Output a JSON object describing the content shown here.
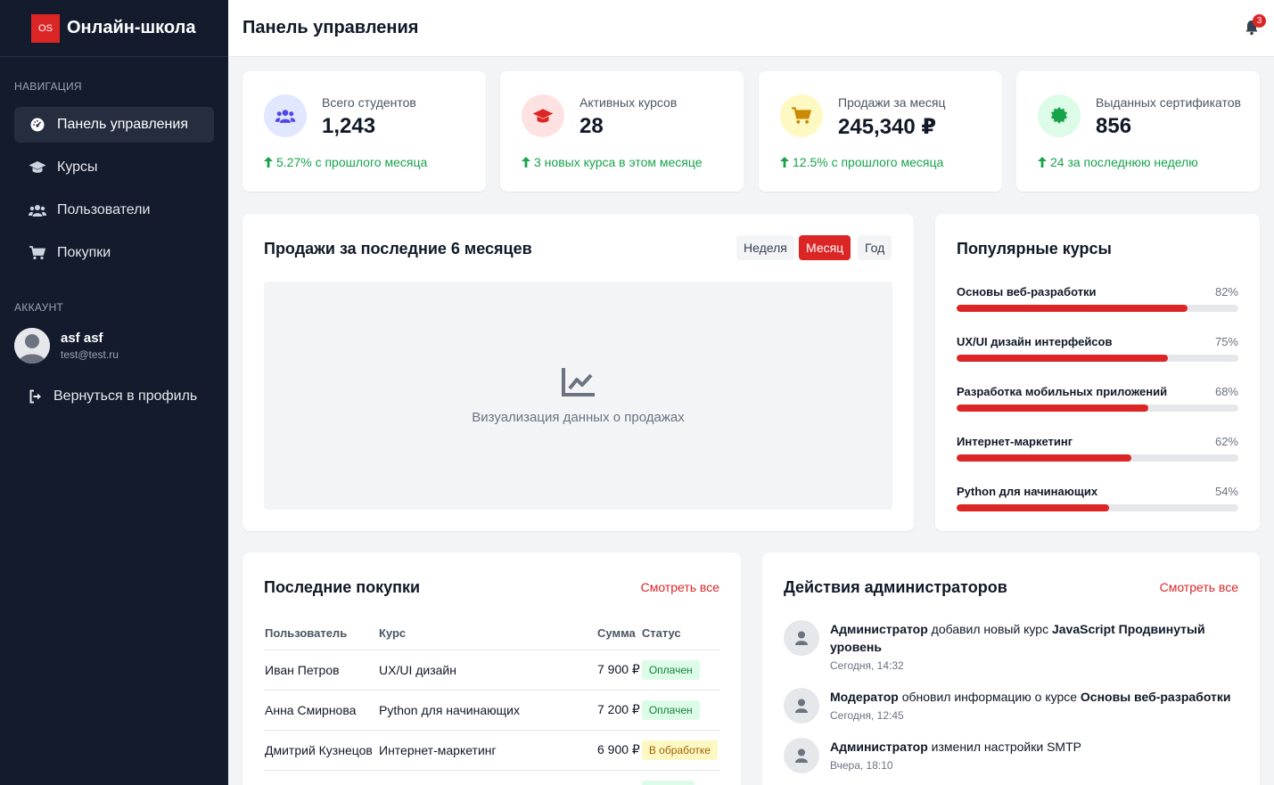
{
  "brand": {
    "logo": "OS",
    "name": "Онлайн-школа"
  },
  "sidebar": {
    "nav_title": "НАВИГАЦИЯ",
    "items": [
      {
        "label": "Панель управления",
        "icon": "dashboard-icon",
        "active": true
      },
      {
        "label": "Курсы",
        "icon": "graduation-cap-icon"
      },
      {
        "label": "Пользователи",
        "icon": "users-icon"
      },
      {
        "label": "Покупки",
        "icon": "cart-icon"
      }
    ],
    "account_title": "АККАУНТ",
    "user": {
      "name": "asf asf",
      "email": "test@test.ru"
    },
    "back_label": "Вернуться в профиль"
  },
  "header": {
    "title": "Панель управления",
    "notifications": "3"
  },
  "stats": [
    {
      "label": "Всего студентов",
      "value": "1,243",
      "change": "5.27% с прошлого месяца",
      "icon": "users-icon",
      "color": "#4f46e5",
      "bg": "#e0e7ff"
    },
    {
      "label": "Активных курсов",
      "value": "28",
      "change": "3 новых курса в этом месяце",
      "icon": "graduation-cap-icon",
      "color": "#dc2626",
      "bg": "#fee2e2"
    },
    {
      "label": "Продажи за месяц",
      "value": "245,340 ₽",
      "change": "12.5% с прошлого месяца",
      "icon": "cart-icon",
      "color": "#ca8a04",
      "bg": "#fef9c3"
    },
    {
      "label": "Выданных сертификатов",
      "value": "856",
      "change": "24 за последнюю неделю",
      "icon": "certificate-icon",
      "color": "#16a34a",
      "bg": "#dcfce7"
    }
  ],
  "sales": {
    "title": "Продажи за последние 6 месяцев",
    "periods": [
      "Неделя",
      "Месяц",
      "Год"
    ],
    "active_period": "Месяц",
    "placeholder": "Визуализация данных о продажах"
  },
  "popular": {
    "title": "Популярные курсы",
    "courses": [
      {
        "name": "Основы веб-разработки",
        "pct": "82%",
        "value": 82
      },
      {
        "name": "UX/UI дизайн интерфейсов",
        "pct": "75%",
        "value": 75
      },
      {
        "name": "Разработка мобильных приложений",
        "pct": "68%",
        "value": 68
      },
      {
        "name": "Интернет-маркетинг",
        "pct": "62%",
        "value": 62
      },
      {
        "name": "Python для начинающих",
        "pct": "54%",
        "value": 54
      }
    ]
  },
  "purchases": {
    "title": "Последние покупки",
    "see_all": "Смотреть все",
    "columns": [
      "Пользователь",
      "Курс",
      "Сумма",
      "Статус"
    ],
    "rows": [
      {
        "user": "Иван Петров",
        "course": "UX/UI дизайн",
        "sum": "7 900 ₽",
        "status": "Оплачен",
        "state": "paid"
      },
      {
        "user": "Анна Смирнова",
        "course": "Python для начинающих",
        "sum": "7 200 ₽",
        "status": "Оплачен",
        "state": "paid"
      },
      {
        "user": "Дмитрий Кузнецов",
        "course": "Интернет-маркетинг",
        "sum": "6 900 ₽",
        "status": "В обработке",
        "state": "proc"
      }
    ]
  },
  "admin": {
    "title": "Действия администраторов",
    "see_all": "Смотреть все",
    "items": [
      {
        "actor": "Администратор",
        "action": "добавил новый курс",
        "target": "JavaScript Продвинутый уровень",
        "time": "Сегодня, 14:32"
      },
      {
        "actor": "Модератор",
        "action": "обновил информацию о курсе",
        "target": "Основы веб-разработки",
        "time": "Сегодня, 12:45"
      },
      {
        "actor": "Администратор",
        "action": "изменил настройки SMTP",
        "target": "",
        "time": "Вчера, 18:10"
      }
    ]
  },
  "colors": {
    "accent": "#dc2626",
    "sidebar_bg": "#141b2d",
    "success": "#16a34a"
  }
}
